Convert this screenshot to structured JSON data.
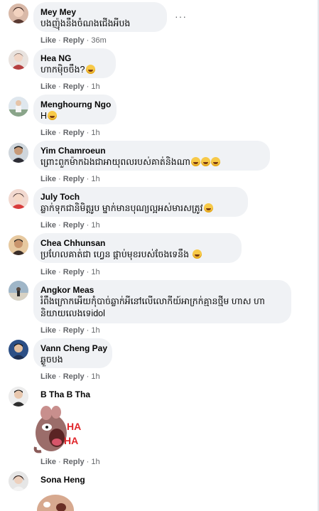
{
  "action_like": "Like",
  "action_reply": "Reply",
  "dot": "·",
  "more_glyph": "···",
  "comments": [
    {
      "name": "Mey Mey",
      "text": "បងញ៉ុងនឹងចំណងជើងអីបង",
      "time": "36m"
    },
    {
      "name": "Hea NG",
      "text": "ហាកម៉ិចចឹង?",
      "time": "1h"
    },
    {
      "name": "Menghourng Ngo",
      "text": "H",
      "time": "1h"
    },
    {
      "name": "Yim Chamroeun",
      "text": "ព្រោះពួកម៉ាកឯងជាអាយុពលរបស់គាត់និងណា",
      "time": "1h"
    },
    {
      "name": "July Toch",
      "text": "ឆ្លាក់ទុកជានិមិត្តរូប ម្នាក់មានបុណ្យល្អអស់មារសត្រូវ",
      "time": "1h"
    },
    {
      "name": "Chea Chhunsan",
      "text": "ប្រហែលគាត់ជា ហ្វេន ផ្កាប់មុខរបស់ចែងទេនឹង",
      "time": "1h"
    },
    {
      "name": "Angkor Meas",
      "text": "រំពឹងក្រោកអើយកុំបាច់ឆ្លាក់អីនៅលើលោកីយ៍អាក្រក់គ្មានថ្មីម ហាស ហា និយាយលេងទេidol",
      "time": "1h"
    },
    {
      "name": "Vann Cheng Pay",
      "text": "ឆ្ងួចបង",
      "time": "1h"
    },
    {
      "name": "B Tha B Tha",
      "sticker_text": "HA HA",
      "time": "1h"
    },
    {
      "name": "Sona Heng"
    }
  ]
}
